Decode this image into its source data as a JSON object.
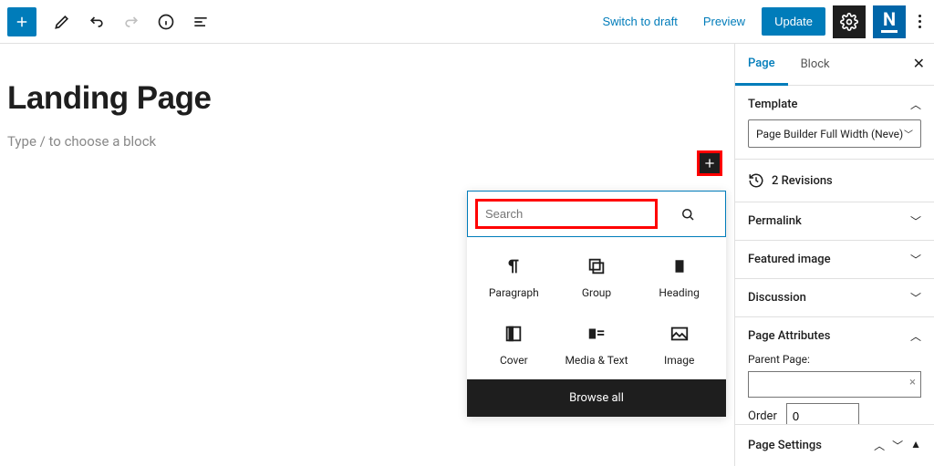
{
  "toolbar": {
    "switch_to_draft": "Switch to draft",
    "preview": "Preview",
    "update": "Update",
    "theme_letter": "N"
  },
  "editor": {
    "title": "Landing Page",
    "placeholder": "Type / to choose a block"
  },
  "inserter": {
    "search_placeholder": "Search",
    "blocks": [
      {
        "label": "Paragraph"
      },
      {
        "label": "Group"
      },
      {
        "label": "Heading"
      },
      {
        "label": "Cover"
      },
      {
        "label": "Media & Text"
      },
      {
        "label": "Image"
      }
    ],
    "browse_all": "Browse all"
  },
  "sidebar": {
    "tabs": {
      "page": "Page",
      "block": "Block"
    },
    "template": {
      "title": "Template",
      "value": "Page Builder Full Width (Neve)"
    },
    "revisions": "2 Revisions",
    "panels": {
      "permalink": "Permalink",
      "featured_image": "Featured image",
      "discussion": "Discussion",
      "page_attributes": "Page Attributes"
    },
    "page_attributes": {
      "parent_label": "Parent Page:",
      "parent_value": "",
      "order_label": "Order",
      "order_value": "0"
    },
    "page_settings": "Page Settings"
  }
}
